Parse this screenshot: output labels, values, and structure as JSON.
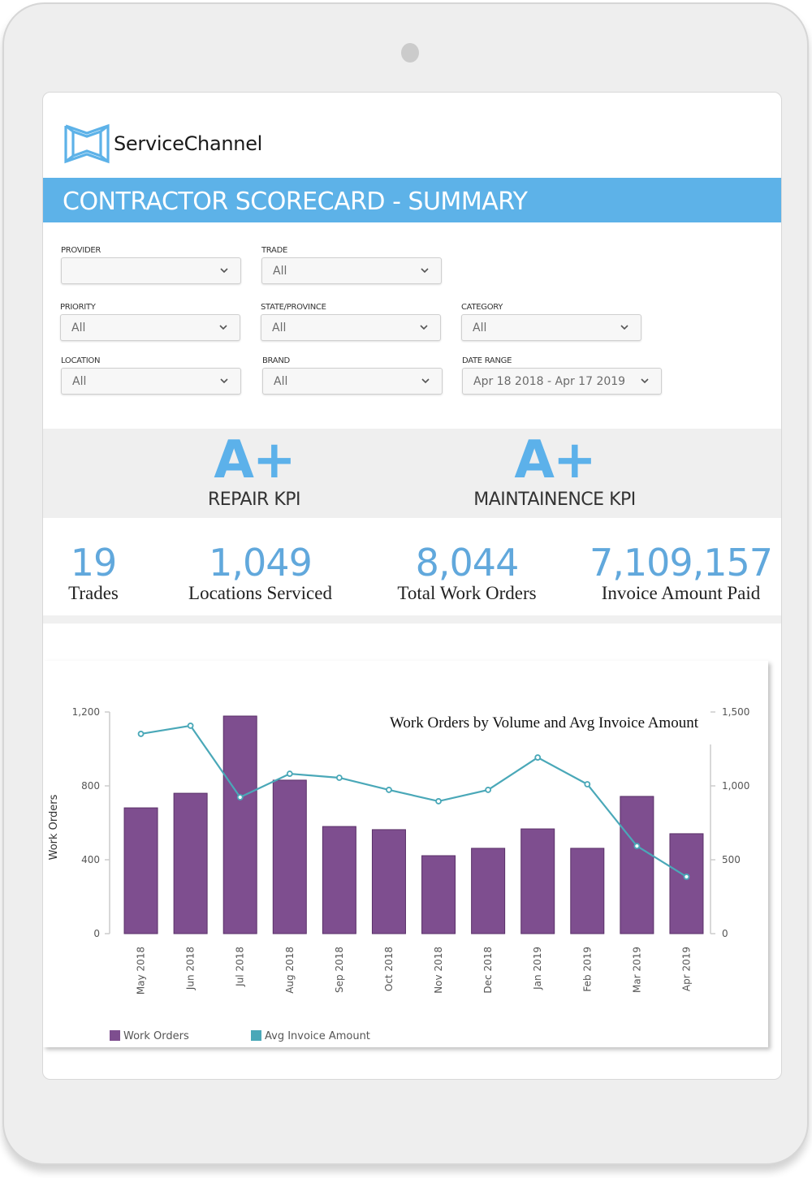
{
  "app": {
    "brand": "ServiceChannel",
    "page_title": "CONTRACTOR SCORECARD - SUMMARY",
    "colors": {
      "accent": "#5db2e8",
      "bar": "#7e4e8f",
      "line": "#4aa8b8",
      "kpi_grade": "#5cb1ea",
      "stat_value": "#61a8dc"
    }
  },
  "filters": [
    {
      "label": "PROVIDER",
      "value": ""
    },
    {
      "label": "TRADE",
      "value": "All"
    },
    {
      "label": "PRIORITY",
      "value": "All"
    },
    {
      "label": "STATE/PROVINCE",
      "value": "All"
    },
    {
      "label": "CATEGORY",
      "value": "All"
    },
    {
      "label": "LOCATION",
      "value": "All"
    },
    {
      "label": "BRAND",
      "value": "All"
    },
    {
      "label": "DATE RANGE",
      "value": "Apr 18 2018 - Apr 17 2019"
    }
  ],
  "kpis": [
    {
      "grade": "A+",
      "label": "REPAIR KPI"
    },
    {
      "grade": "A+",
      "label": "MAINTAINENCE KPI"
    }
  ],
  "stats": [
    {
      "value": "19",
      "label": "Trades"
    },
    {
      "value": "1,049",
      "label": "Locations Serviced"
    },
    {
      "value": "8,044",
      "label": "Total Work Orders"
    },
    {
      "value": "7,109,157",
      "label": "Invoice Amount Paid"
    }
  ],
  "chart_data": {
    "type": "bar",
    "title": "Work Orders by Volume and Avg Invoice Amount",
    "xlabel": "",
    "ylabel": "Work Orders",
    "y2label": "",
    "categories": [
      "May 2018",
      "Jun 2018",
      "Jul 2018",
      "Aug 2018",
      "Sep 2018",
      "Oct 2018",
      "Nov 2018",
      "Dec 2018",
      "Jan 2019",
      "Feb 2019",
      "Mar 2019",
      "Apr 2019"
    ],
    "series": [
      {
        "name": "Work Orders",
        "type": "bar",
        "axis": "left",
        "color": "#7e4e8f",
        "values": [
          681,
          760,
          1178,
          831,
          580,
          563,
          422,
          462,
          567,
          462,
          743,
          541
        ]
      },
      {
        "name": "Avg Invoice Amount",
        "type": "line",
        "axis": "right",
        "color": "#4aa8b8",
        "values": [
          1352,
          1407,
          923,
          1082,
          1055,
          973,
          896,
          973,
          1192,
          1011,
          593,
          385
        ]
      }
    ],
    "ylim": [
      0,
      1200
    ],
    "y_ticks": [
      0,
      400,
      800,
      1200
    ],
    "y_tick_labels": [
      "0",
      "400",
      "800",
      "1,200"
    ],
    "y2lim": [
      0,
      1500
    ],
    "y2_ticks": [
      0,
      500,
      1000,
      1500
    ],
    "y2_tick_labels": [
      "0",
      "500",
      "1,000",
      "1,500"
    ],
    "grid": false,
    "legend": {
      "position": "bottom-left",
      "entries": [
        "Work Orders",
        "Avg Invoice Amount"
      ]
    }
  }
}
